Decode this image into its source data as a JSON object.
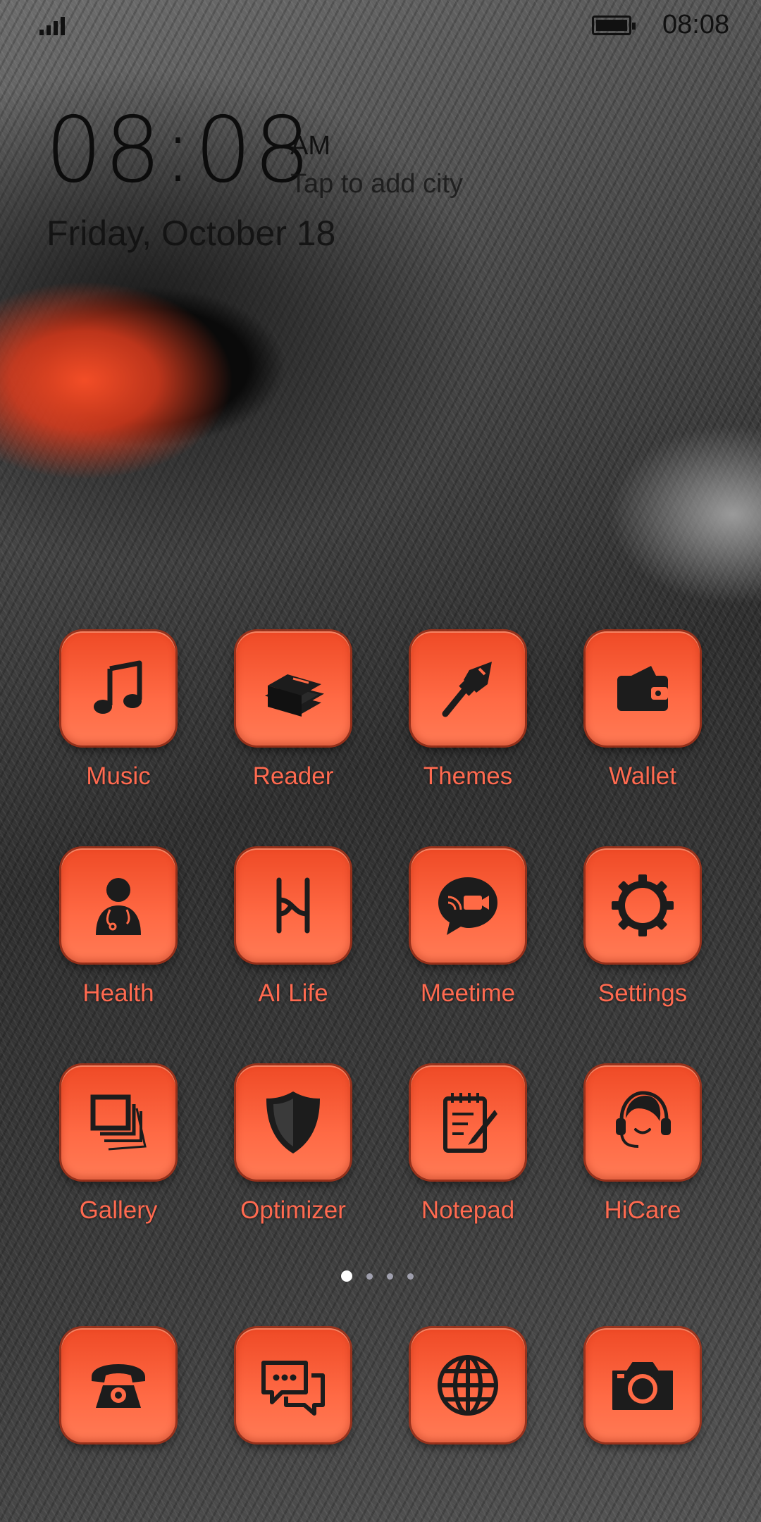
{
  "status_bar": {
    "time": "08:08",
    "battery_level": 1.0,
    "signal_icon": "signal-bars-icon",
    "battery_icon": "battery-icon"
  },
  "clock_widget": {
    "time": "08:08",
    "ampm": "AM",
    "city_prompt": "Tap to add city",
    "date": "Friday, October 18"
  },
  "apps": [
    {
      "label": "Music",
      "icon": "music-note-icon"
    },
    {
      "label": "Reader",
      "icon": "books-icon"
    },
    {
      "label": "Themes",
      "icon": "paintbrush-icon"
    },
    {
      "label": "Wallet",
      "icon": "wallet-icon"
    },
    {
      "label": "Health",
      "icon": "doctor-icon"
    },
    {
      "label": "AI Life",
      "icon": "ai-life-icon"
    },
    {
      "label": "Meetime",
      "icon": "video-chat-icon"
    },
    {
      "label": "Settings",
      "icon": "gear-icon"
    },
    {
      "label": "Gallery",
      "icon": "photos-icon"
    },
    {
      "label": "Optimizer",
      "icon": "shield-icon"
    },
    {
      "label": "Notepad",
      "icon": "notepad-icon"
    },
    {
      "label": "HiCare",
      "icon": "headset-icon"
    }
  ],
  "page_indicator": {
    "pages": 4,
    "current": 1
  },
  "dock": [
    {
      "icon": "phone-icon"
    },
    {
      "icon": "messages-icon"
    },
    {
      "icon": "globe-icon"
    },
    {
      "icon": "camera-icon"
    }
  ],
  "colors": {
    "icon_tile": "#ff5a36",
    "label": "#ff6a50",
    "glyph": "#1a1a1a"
  }
}
